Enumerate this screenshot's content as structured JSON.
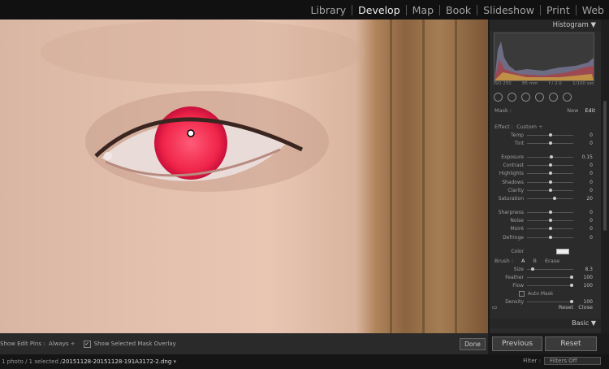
{
  "modules": [
    "Library",
    "Develop",
    "Map",
    "Book",
    "Slideshow",
    "Print",
    "Web"
  ],
  "active_module": "Develop",
  "panel": {
    "histogram_title": "Histogram",
    "histogram_info": {
      "iso": "ISO 250",
      "focal": "85 mm",
      "aperture": "f / 2.0",
      "shutter": "1/100 sec"
    },
    "mask_label": "Mask :",
    "mask_new": "New",
    "mask_edit": "Edit",
    "effect_label": "Effect :",
    "effect_value": "Custom",
    "sliders_group1": [
      {
        "label": "Temp",
        "value": "0",
        "pos": 0.5
      },
      {
        "label": "Tint",
        "value": "0",
        "pos": 0.5
      }
    ],
    "sliders_group2": [
      {
        "label": "Exposure",
        "value": "0.15",
        "pos": 0.52
      },
      {
        "label": "Contrast",
        "value": "0",
        "pos": 0.5
      },
      {
        "label": "Highlights",
        "value": "0",
        "pos": 0.5
      },
      {
        "label": "Shadows",
        "value": "0",
        "pos": 0.5
      },
      {
        "label": "Clarity",
        "value": "0",
        "pos": 0.5
      },
      {
        "label": "Saturation",
        "value": "20",
        "pos": 0.6
      }
    ],
    "sliders_group3": [
      {
        "label": "Sharpness",
        "value": "0",
        "pos": 0.5
      },
      {
        "label": "Noise",
        "value": "0",
        "pos": 0.5
      },
      {
        "label": "Moiré",
        "value": "0",
        "pos": 0.5
      },
      {
        "label": "Defringe",
        "value": "0",
        "pos": 0.5
      }
    ],
    "color_label": "Color",
    "brush_label": "Brush :",
    "brush_a": "A",
    "brush_b": "B",
    "brush_erase": "Erase",
    "brush_sliders": [
      {
        "label": "Size",
        "value": "8.3",
        "pos": 0.1
      },
      {
        "label": "Feather",
        "value": "100",
        "pos": 1.0
      },
      {
        "label": "Flow",
        "value": "100",
        "pos": 1.0
      }
    ],
    "auto_mask_label": "Auto Mask",
    "density": {
      "label": "Density",
      "value": "100",
      "pos": 1.0
    },
    "reset_label": "Reset",
    "close_label": "Close",
    "basic_title": "Basic"
  },
  "toolbar": {
    "show_pins_label": "Show Edit Pins :",
    "show_pins_value": "Always",
    "overlay_label": "Show Selected Mask Overlay",
    "done_label": "Done"
  },
  "previous_label": "Previous",
  "reset_button_label": "Reset",
  "filmstrip": {
    "info": "1 photo / 1 selected / ",
    "filename": "20151128-20151128-191A3172-2.dng",
    "filter_label": "Filter :",
    "filter_value": "Filters Off"
  },
  "colors": {
    "mask_overlay": "#ff2a52",
    "panel_bg": "#2b2b2b"
  }
}
